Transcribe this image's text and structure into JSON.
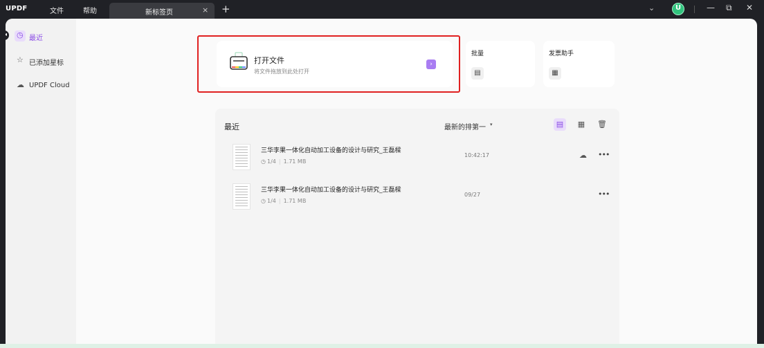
{
  "app": {
    "logo_text": "UPDF",
    "menu": [
      "文件",
      "帮助"
    ]
  },
  "tabs": [
    {
      "title": "新标签页",
      "close_glyph": "×"
    }
  ],
  "titlebar": {
    "new_tab_glyph": "+",
    "dropdown_glyph": "⌄",
    "avatar_glyph": "U",
    "minimize_glyph": "—",
    "restore_glyph": "⧉",
    "close_glyph": "✕"
  },
  "sidebar": {
    "items": [
      {
        "label": "最近",
        "icon": "clock-icon",
        "glyph": "◷",
        "active": true
      },
      {
        "label": "已添加星标",
        "icon": "star-icon",
        "glyph": "☆",
        "active": false
      },
      {
        "label": "UPDF Cloud",
        "icon": "cloud-icon",
        "glyph": "☁",
        "active": false
      }
    ]
  },
  "open_file": {
    "title": "打开文件",
    "subtitle": "将文件拖放到此处打开",
    "arrow_glyph": "›"
  },
  "tools": [
    {
      "title": "批量",
      "icon": "batch-icon",
      "glyph": "▤"
    },
    {
      "title": "发票助手",
      "icon": "invoice-icon",
      "glyph": "▦"
    }
  ],
  "recent": {
    "heading": "最近",
    "sort_label": "最新的排第一",
    "sort_caret": "▾",
    "view_glyphs": {
      "list": "▤",
      "grid": "▦",
      "delete": "🗑"
    },
    "files": [
      {
        "name": "三华李果一体化自动加工设备的设计与研究_王磊樑",
        "pages": "1/4",
        "size": "1.71 MB",
        "time": "10:42:17",
        "cloud": true
      },
      {
        "name": "三华李果一体化自动加工设备的设计与研究_王磊樑",
        "pages": "1/4",
        "size": "1.71 MB",
        "time": "09/27",
        "cloud": false
      }
    ]
  },
  "colors": {
    "accent": "#8a4be6",
    "highlight_border": "#e02020",
    "titlebar_bg": "#202126"
  }
}
